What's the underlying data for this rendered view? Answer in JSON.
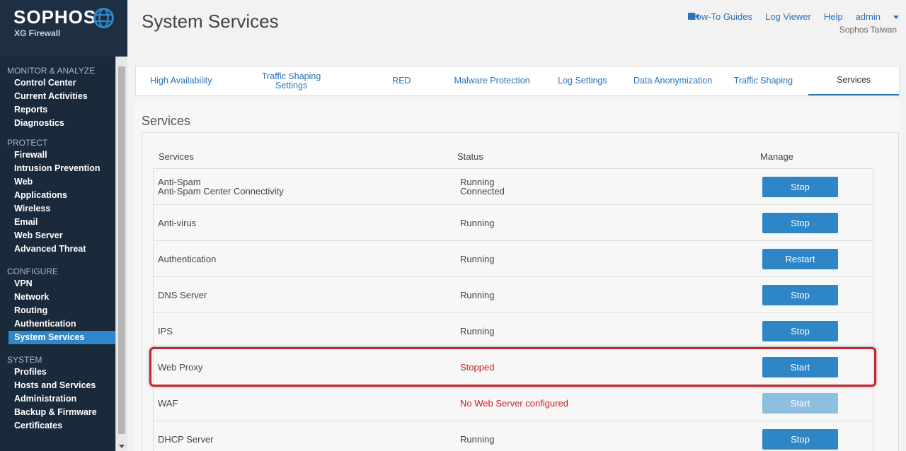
{
  "brand": {
    "name": "SOPHOS",
    "product": "XG Firewall"
  },
  "header": {
    "title": "System Services",
    "links": {
      "guides": "How-To Guides",
      "log_viewer": "Log Viewer",
      "help": "Help",
      "user": "admin"
    },
    "subtitle": "Sophos Taiwan"
  },
  "sidebar": {
    "sections": [
      {
        "label": "MONITOR & ANALYZE",
        "items": [
          "Control Center",
          "Current Activities",
          "Reports",
          "Diagnostics"
        ]
      },
      {
        "label": "PROTECT",
        "items": [
          "Firewall",
          "Intrusion Prevention",
          "Web",
          "Applications",
          "Wireless",
          "Email",
          "Web Server",
          "Advanced Threat"
        ]
      },
      {
        "label": "CONFIGURE",
        "items": [
          "VPN",
          "Network",
          "Routing",
          "Authentication",
          "System Services"
        ]
      },
      {
        "label": "SYSTEM",
        "items": [
          "Profiles",
          "Hosts and Services",
          "Administration",
          "Backup & Firmware",
          "Certificates"
        ]
      }
    ],
    "active_item": "System Services"
  },
  "tabs": [
    {
      "label": "High Availability",
      "active": false
    },
    {
      "label": "Traffic Shaping Settings",
      "active": false
    },
    {
      "label": "RED",
      "active": false
    },
    {
      "label": "Malware Protection",
      "active": false
    },
    {
      "label": "Log Settings",
      "active": false
    },
    {
      "label": "Data Anonymization",
      "active": false
    },
    {
      "label": "Traffic Shaping",
      "active": false
    },
    {
      "label": "Services",
      "active": true
    }
  ],
  "services": {
    "section_title": "Services",
    "columns": {
      "service": "Services",
      "status": "Status",
      "manage": "Manage"
    },
    "rows": [
      {
        "service": [
          "Anti-Spam",
          "Anti-Spam Center Connectivity"
        ],
        "status": [
          "Running",
          "Connected"
        ],
        "status_color": "normal",
        "action": "Stop",
        "enabled": true
      },
      {
        "service": [
          "Anti-virus"
        ],
        "status": [
          "Running"
        ],
        "status_color": "normal",
        "action": "Stop",
        "enabled": true
      },
      {
        "service": [
          "Authentication"
        ],
        "status": [
          "Running"
        ],
        "status_color": "normal",
        "action": "Restart",
        "enabled": true
      },
      {
        "service": [
          "DNS Server"
        ],
        "status": [
          "Running"
        ],
        "status_color": "normal",
        "action": "Stop",
        "enabled": true
      },
      {
        "service": [
          "IPS"
        ],
        "status": [
          "Running"
        ],
        "status_color": "normal",
        "action": "Stop",
        "enabled": true
      },
      {
        "service": [
          "Web Proxy"
        ],
        "status": [
          "Stopped"
        ],
        "status_color": "red",
        "action": "Start",
        "enabled": true,
        "highlighted": true
      },
      {
        "service": [
          "WAF"
        ],
        "status": [
          "No Web Server configured"
        ],
        "status_color": "red",
        "action": "Start",
        "enabled": false
      },
      {
        "service": [
          "DHCP Server"
        ],
        "status": [
          "Running"
        ],
        "status_color": "normal",
        "action": "Stop",
        "enabled": true
      }
    ]
  },
  "colors": {
    "accent": "#2e86c6",
    "sidebar_bg": "#1b2a3b",
    "error": "#d21b1b",
    "highlight_border": "#c0272d"
  }
}
